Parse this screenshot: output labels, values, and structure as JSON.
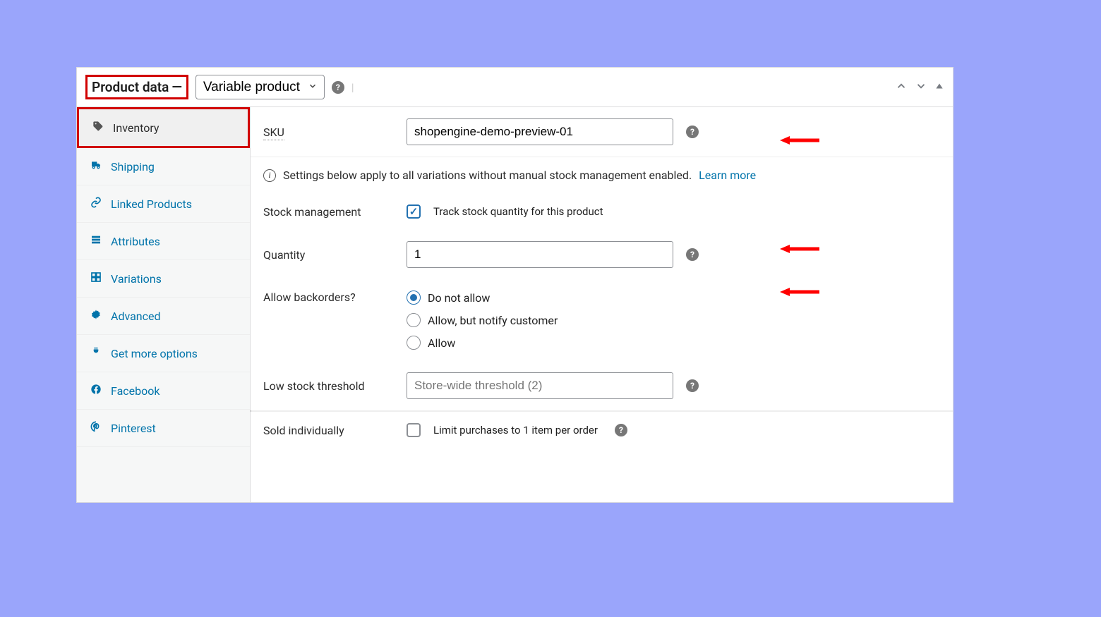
{
  "header": {
    "title": "Product data",
    "dash": "—",
    "product_type": "Variable product"
  },
  "sidebar": {
    "items": [
      {
        "label": "Inventory",
        "icon": "tag-icon",
        "active": true
      },
      {
        "label": "Shipping",
        "icon": "truck-icon"
      },
      {
        "label": "Linked Products",
        "icon": "link-icon"
      },
      {
        "label": "Attributes",
        "icon": "list-icon"
      },
      {
        "label": "Variations",
        "icon": "grid-icon"
      },
      {
        "label": "Advanced",
        "icon": "gear-icon"
      },
      {
        "label": "Get more options",
        "icon": "plug-icon"
      },
      {
        "label": "Facebook",
        "icon": "facebook-icon"
      },
      {
        "label": "Pinterest",
        "icon": "pinterest-icon"
      }
    ]
  },
  "fields": {
    "sku": {
      "label": "SKU",
      "value": "shopengine-demo-preview-01"
    },
    "info_text": "Settings below apply to all variations without manual stock management enabled.",
    "learn_more": "Learn more",
    "stock_mgmt": {
      "label": "Stock management",
      "checkbox_label": "Track stock quantity for this product",
      "checked": true
    },
    "quantity": {
      "label": "Quantity",
      "value": "1"
    },
    "backorders": {
      "label": "Allow backorders?",
      "options": [
        {
          "label": "Do not allow",
          "selected": true
        },
        {
          "label": "Allow, but notify customer",
          "selected": false
        },
        {
          "label": "Allow",
          "selected": false
        }
      ]
    },
    "low_stock": {
      "label": "Low stock threshold",
      "placeholder": "Store-wide threshold (2)"
    },
    "sold_individually": {
      "label": "Sold individually",
      "checkbox_label": "Limit purchases to 1 item per order",
      "checked": false
    }
  }
}
